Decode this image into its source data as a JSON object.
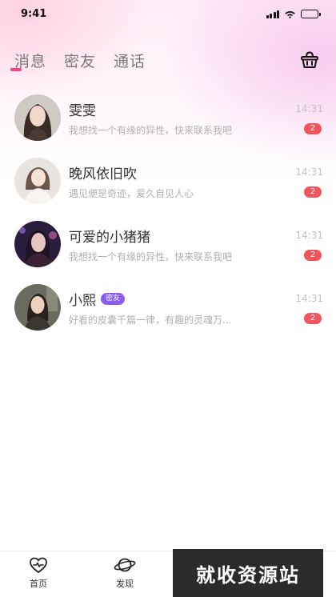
{
  "status_bar": {
    "time": "9:41"
  },
  "tabs": [
    {
      "label": "消息"
    },
    {
      "label": "密友"
    },
    {
      "label": "通话"
    }
  ],
  "icons": {
    "basket": "basket-icon",
    "home": "heart-home-icon",
    "discover": "planet-icon"
  },
  "colors": {
    "accent": "#ff3f7f",
    "unread_badge": "#f2545b",
    "friend_badge": "#8a5cf0"
  },
  "messages": [
    {
      "name": "雯雯",
      "preview": "我想找一个有缘的异性，快来联系我吧",
      "time": "14:31",
      "unread": "2",
      "badge": ""
    },
    {
      "name": "晚风依旧吹",
      "preview": "遇见便是奇迹，爱久自见人心",
      "time": "14:31",
      "unread": "2",
      "badge": ""
    },
    {
      "name": "可爱的小猪猪",
      "preview": "我想找一个有缘的异性，快来联系我吧",
      "time": "14:31",
      "unread": "2",
      "badge": ""
    },
    {
      "name": "小熙",
      "preview": "好看的皮囊千篇一律，有趣的灵魂万...",
      "time": "14:31",
      "unread": "2",
      "badge": "密友"
    }
  ],
  "bottom_nav": [
    {
      "label": "首页"
    },
    {
      "label": "发现"
    }
  ],
  "watermark": "就收资源站"
}
